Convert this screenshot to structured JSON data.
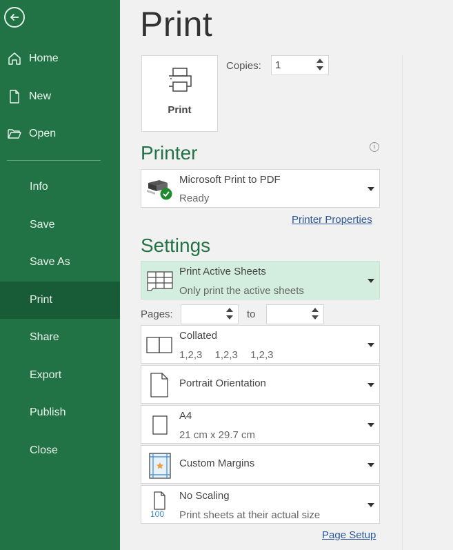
{
  "sidebar": {
    "back_icon": "arrow-left-circle-icon",
    "top_items": [
      {
        "label": "Home",
        "icon": "home-icon"
      },
      {
        "label": "New",
        "icon": "new-document-icon"
      },
      {
        "label": "Open",
        "icon": "folder-open-icon"
      }
    ],
    "bottom_items": [
      {
        "label": "Info"
      },
      {
        "label": "Save"
      },
      {
        "label": "Save As"
      },
      {
        "label": "Print",
        "active": true
      },
      {
        "label": "Share"
      },
      {
        "label": "Export"
      },
      {
        "label": "Publish"
      },
      {
        "label": "Close"
      }
    ]
  },
  "main": {
    "title": "Print",
    "print_button_label": "Print",
    "copies": {
      "label": "Copies:",
      "value": "1"
    },
    "printer": {
      "heading": "Printer",
      "name": "Microsoft Print to PDF",
      "status": "Ready",
      "properties_link": "Printer Properties"
    },
    "settings": {
      "heading": "Settings",
      "print_what": {
        "title": "Print Active Sheets",
        "subtitle": "Only print the active sheets"
      },
      "pages": {
        "label": "Pages:",
        "from_value": "",
        "to_label": "to",
        "to_value": ""
      },
      "collation": {
        "title": "Collated",
        "subtitle_parts": [
          "1,2,3",
          "1,2,3",
          "1,2,3"
        ]
      },
      "orientation": {
        "title": "Portrait Orientation"
      },
      "paper": {
        "title": "A4",
        "subtitle": "21 cm x 29.7 cm"
      },
      "margins": {
        "title": "Custom Margins"
      },
      "scaling": {
        "title": "No Scaling",
        "subtitle": "Print sheets at their actual size",
        "icon_badge": "100"
      },
      "page_setup_link": "Page Setup"
    }
  },
  "colors": {
    "sidebar_bg": "#217346",
    "sidebar_active": "#185c37",
    "heading_green": "#217346",
    "selected_dropdown_bg": "#d3eedf",
    "link_blue": "#2b579a"
  }
}
